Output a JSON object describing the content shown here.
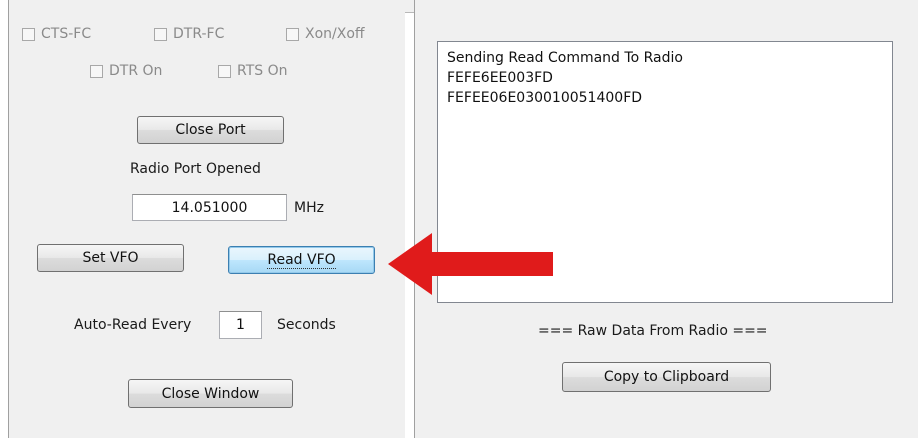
{
  "serial_flags": {
    "cts_fc": "CTS-FC",
    "dtr_fc": "DTR-FC",
    "xon_xoff": "Xon/Xoff",
    "dtr_on": "DTR On",
    "rts_on": "RTS On"
  },
  "port": {
    "close_port_label": "Close Port",
    "status": "Radio Port Opened"
  },
  "frequency": {
    "value": "14.051000",
    "unit": "MHz"
  },
  "vfo": {
    "set_label": "Set VFO",
    "read_label": "Read VFO"
  },
  "auto_read": {
    "prefix": "Auto-Read Every",
    "interval": "1",
    "suffix": "Seconds"
  },
  "close_window_label": "Close Window",
  "log": {
    "lines": [
      "Sending Read Command To Radio",
      "FEFE6EE003FD",
      "FEFEE06E030010051400FD"
    ],
    "caption": "=== Raw Data From Radio ===",
    "copy_label": "Copy to Clipboard"
  },
  "annotation": {
    "arrow_color": "#e01b1b"
  }
}
